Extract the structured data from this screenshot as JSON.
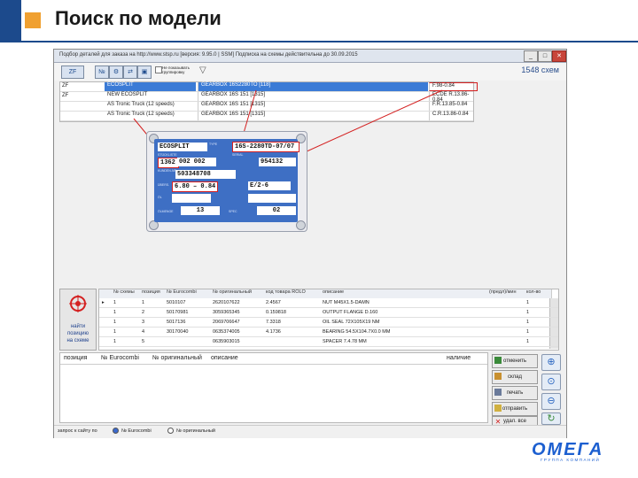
{
  "slide": {
    "title": "Поиск по модели"
  },
  "window": {
    "title": "Подбор деталей для заказа на http://www.stsp.ru [версия: 9.95.0 | SSM] Подписка на схемы действительна до 30.09.2015",
    "buttons": {
      "minimize": "_",
      "maximize": "□",
      "close": "✕"
    }
  },
  "toolbar": {
    "group_checkbox_label": "Не показывать группировку",
    "count_text": "1548 схем"
  },
  "models": [
    {
      "col1": "ZF",
      "col2": "ECOSPLIT",
      "col3": "GEARBOX 16S2280TO [118]",
      "col4": "F.98-0.84"
    },
    {
      "col1": "ZF",
      "col2": "NEW ECOSPLIT",
      "col3": "GEARBOX 16S 151 [1315]",
      "col4": "ECDE R.13.86-0.84"
    },
    {
      "col1": "",
      "col2": "AS Tronic Truck (12 speeds)",
      "col3": "GEARBOX 16S 151 [1315]",
      "col4": "F.R.13.85-0.84"
    },
    {
      "col1": "",
      "col2": "AS Tronic Truck (12 speeds)",
      "col3": "GEARBOX 16S 151 [1315]",
      "col4": "C.R.13.86-0.84"
    }
  ],
  "plate": {
    "model": "ECOSPLIT",
    "type": "16S-2280TD-07/07",
    "number_a": "1362",
    "number_b": "002 002",
    "serial": "954132",
    "customer_no": "503348708",
    "ratio_a": "6.80",
    "ratio_b": "0.84",
    "ratio_c": "E/2-6",
    "oil_a": "13",
    "oil_b": "02",
    "labels": {
      "typ": "TYPE",
      "stuckliste": "STÜCKLISTE",
      "serial": "SERIAL",
      "customer": "KUNDEN-NR",
      "ratio": "ÜBERS.",
      "oil": "ÖL",
      "oil_qty": "ÖLMENGE",
      "spec": "SPEC"
    }
  },
  "left_panel": {
    "label_line1": "найти",
    "label_line2": "позицию",
    "label_line3": "на схеме"
  },
  "parts_table": {
    "headers": [
      "№ схемы",
      "позиция",
      "№ Eurocombi",
      "№ оригинальный",
      "код товара ROLO",
      "описание",
      "",
      "(предл)/мин",
      "кол-во"
    ],
    "rows": [
      {
        "marker": "▸",
        "scheme": "1",
        "pos": "1",
        "euro": "5010107",
        "orig": "2620107622",
        "rolo": "2.4567",
        "desc": "NUT M45X1.5-DAMN",
        "min": "",
        "qty": "1"
      },
      {
        "marker": "",
        "scheme": "1",
        "pos": "2",
        "euro": "50170981",
        "orig": "3059365345",
        "rolo": "0.159818",
        "desc": "OUTPUT FLANGE D.160",
        "min": "",
        "qty": "1"
      },
      {
        "marker": "",
        "scheme": "1",
        "pos": "3",
        "euro": "5017136",
        "orig": "2069706647",
        "rolo": "7.3318",
        "desc": "OIL SEAL 72X105X19 NM",
        "min": "",
        "qty": "1"
      },
      {
        "marker": "",
        "scheme": "1",
        "pos": "4",
        "euro": "30170040",
        "orig": "0635374005",
        "rolo": "4.1736",
        "desc": "BEARING 54.5X104.7X0.0 MM",
        "min": "",
        "qty": "1"
      },
      {
        "marker": "",
        "scheme": "1",
        "pos": "5",
        "euro": "",
        "orig": "0635903015",
        "rolo": "",
        "desc": "SPACER 7.4.78 MM",
        "min": "",
        "qty": "1"
      }
    ]
  },
  "order_table": {
    "headers": {
      "pos": "позиция",
      "euro": "№ Eurocombi",
      "orig": "№ оригинальный",
      "desc": "описание",
      "avail": "наличие"
    }
  },
  "actions": {
    "cancel": "отменить",
    "stock": "склад",
    "print": "печать",
    "send": "отправить",
    "delete_all": "удал. все"
  },
  "status_bar": {
    "label": "запрос к сайту по",
    "option1": "№ Eurocombi",
    "option2": "№ оригинальный"
  },
  "logo": {
    "text": "ОМЕГА",
    "subtitle": "ГРУППА КОМПАНИЙ"
  },
  "colors": {
    "accent_blue": "#1c4a8c",
    "bullet_orange": "#f0a030",
    "highlight_red": "#d42020",
    "selection_blue": "#3b7bd6"
  }
}
